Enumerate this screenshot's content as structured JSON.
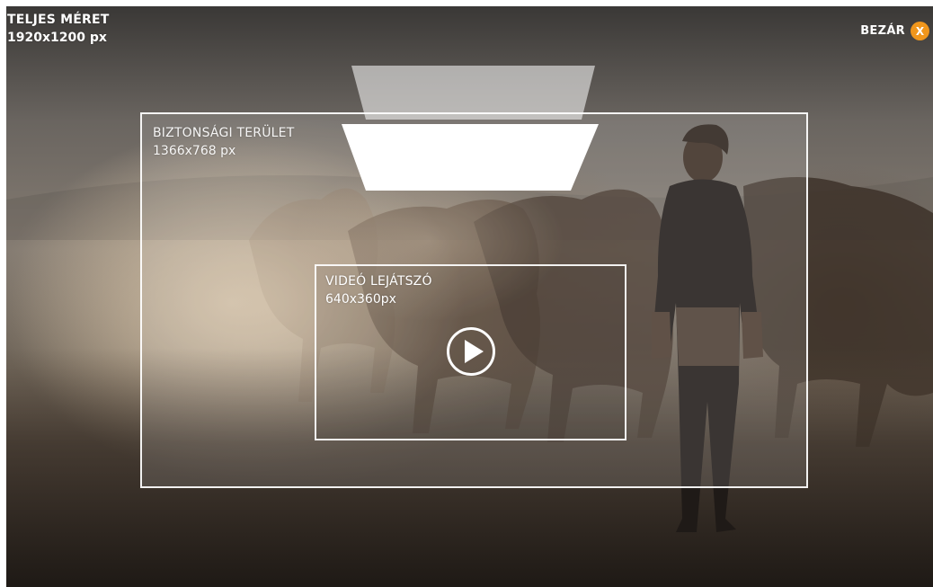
{
  "full_size": {
    "title": "TELJES MÉRET",
    "dimensions": "1920x1200 px"
  },
  "close": {
    "label": "BEZÁR",
    "icon_glyph": "X",
    "icon": "close-icon",
    "accent_color": "#f0961c"
  },
  "safe_area": {
    "title": "BIZTONSÁGI TERÜLET",
    "dimensions": "1366x768 px"
  },
  "video_player": {
    "title": "VIDEÓ LEJÁTSZÓ",
    "dimensions": "640x360px",
    "play_icon": "play-icon"
  }
}
